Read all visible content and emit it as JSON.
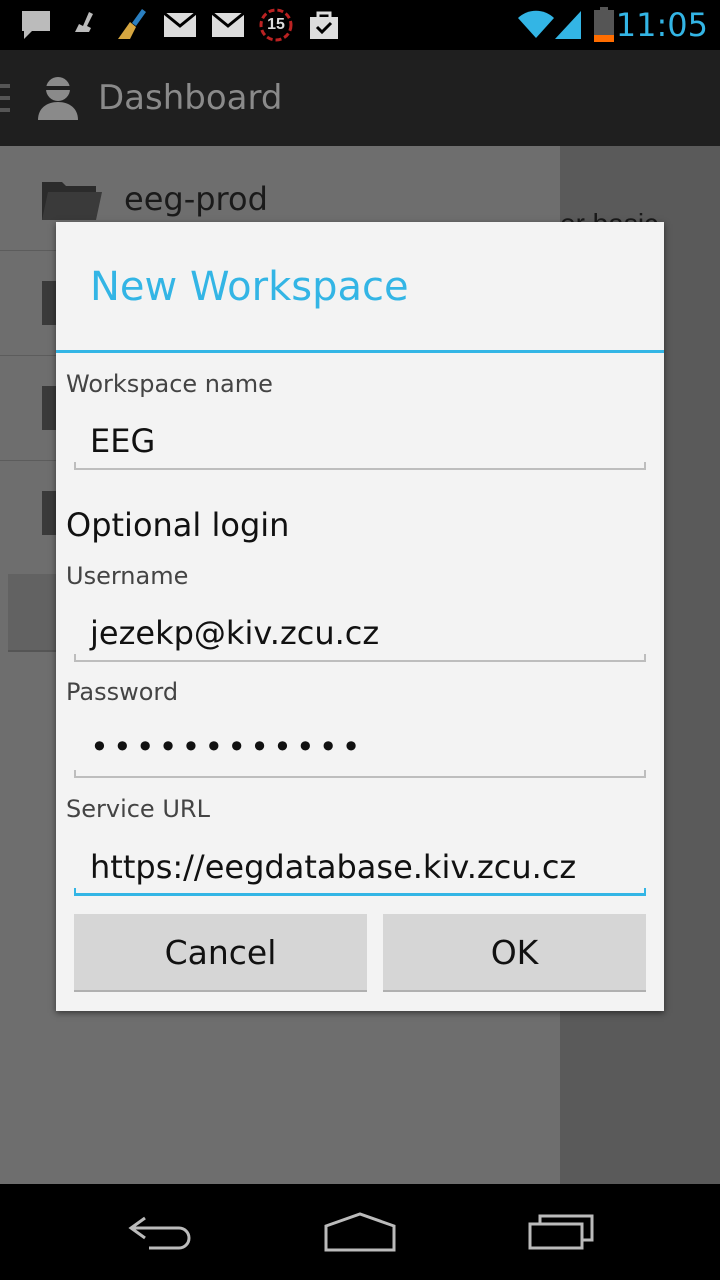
{
  "status_bar": {
    "time": "11:05",
    "calendar_badge": "15",
    "icons": [
      "chat-icon",
      "cleaner-icon",
      "broom-icon",
      "mail-icon",
      "mail-icon",
      "calendar-icon",
      "store-bag-icon",
      "wifi-icon",
      "signal-icon",
      "battery-icon"
    ]
  },
  "action_bar": {
    "title": "Dashboard"
  },
  "background": {
    "first_workspace": "eeg-prod",
    "side_text": "er basic"
  },
  "dialog": {
    "title": "New Workspace",
    "workspace_name_label": "Workspace name",
    "workspace_name_value": "EEG",
    "section_heading": "Optional login",
    "username_label": "Username",
    "username_value": "jezekp@kiv.zcu.cz",
    "password_label": "Password",
    "password_value": "••••••••••••",
    "service_url_label": "Service URL",
    "service_url_value": "https://eegdatabase.kiv.zcu.cz",
    "cancel_label": "Cancel",
    "ok_label": "OK"
  },
  "colors": {
    "accent": "#33b5e5",
    "dialog_bg": "#f3f3f3",
    "button_bg": "#d6d6d6"
  }
}
